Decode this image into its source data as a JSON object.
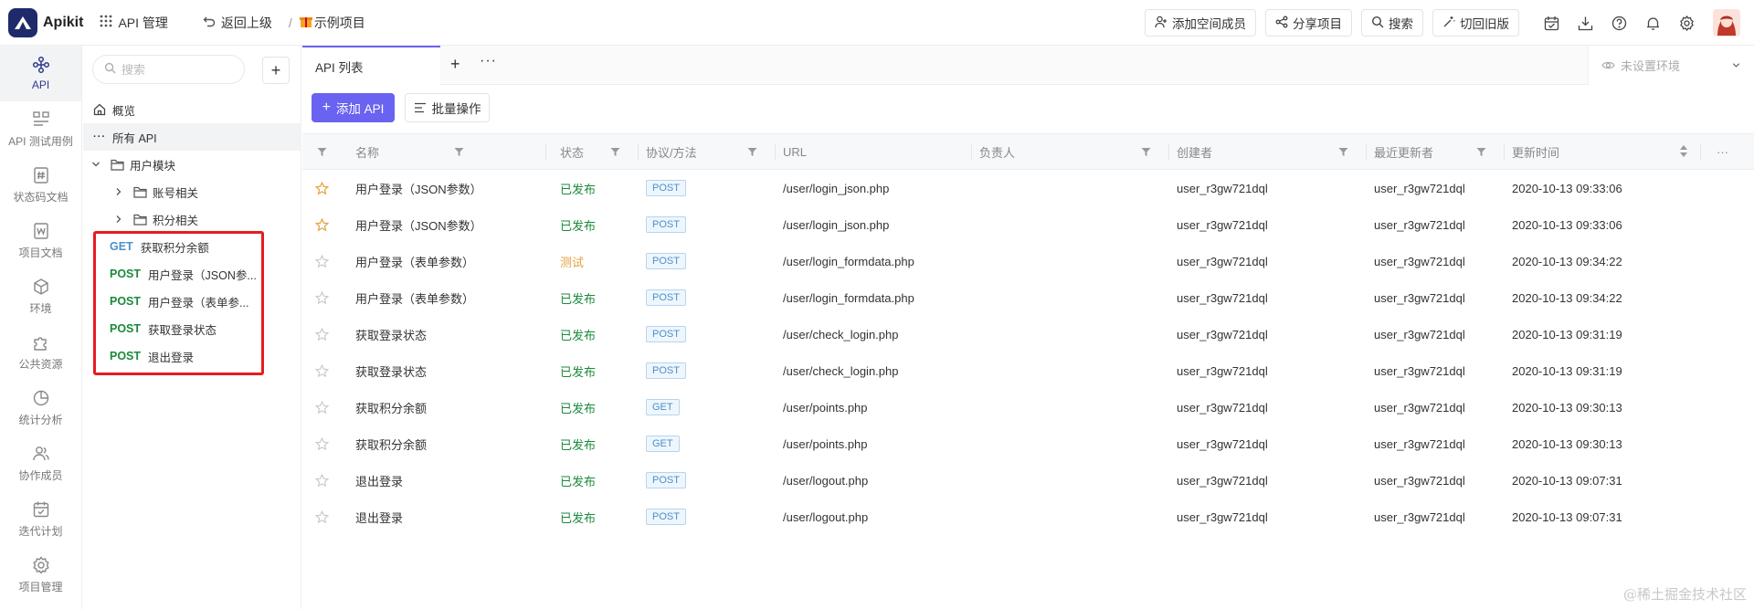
{
  "app": {
    "name": "Apikit"
  },
  "topnav": {
    "api_manage": "API 管理",
    "back": "返回上级",
    "separator": "/",
    "project": "示例项目"
  },
  "top_buttons": {
    "add_member": "添加空间成员",
    "share": "分享项目",
    "search": "搜索",
    "switch_old": "切回旧版"
  },
  "rail": {
    "items": [
      {
        "label": "API",
        "icon": "api-icon",
        "active": true
      },
      {
        "label": "API 测试用例",
        "icon": "test-case-icon"
      },
      {
        "label": "状态码文档",
        "icon": "status-code-icon"
      },
      {
        "label": "项目文档",
        "icon": "project-doc-icon"
      },
      {
        "label": "环境",
        "icon": "environment-icon"
      },
      {
        "label": "公共资源",
        "icon": "public-resource-icon"
      },
      {
        "label": "统计分析",
        "icon": "statistics-icon"
      },
      {
        "label": "协作成员",
        "icon": "members-icon"
      },
      {
        "label": "迭代计划",
        "icon": "iteration-icon"
      },
      {
        "label": "项目管理",
        "icon": "project-manage-icon"
      }
    ]
  },
  "tree": {
    "search_placeholder": "搜索",
    "overview": "概览",
    "all_api": "所有 API",
    "group": "用户模块",
    "subgroups": [
      "账号相关",
      "积分相关"
    ],
    "apis": [
      {
        "method": "GET",
        "name": "获取积分余额"
      },
      {
        "method": "POST",
        "name": "用户登录（JSON参..."
      },
      {
        "method": "POST",
        "name": "用户登录（表单参..."
      },
      {
        "method": "POST",
        "name": "获取登录状态"
      },
      {
        "method": "POST",
        "name": "退出登录"
      }
    ]
  },
  "tabs": {
    "active": "API 列表",
    "env_placeholder": "未设置环境"
  },
  "actions": {
    "add_api": "添加 API",
    "batch": "批量操作"
  },
  "table": {
    "headers": {
      "name": "名称",
      "status": "状态",
      "protocol": "协议/方法",
      "url": "URL",
      "owner": "负责人",
      "creator": "创建者",
      "updater": "最近更新者",
      "updated": "更新时间",
      "more": "···"
    },
    "rows": [
      {
        "starred": true,
        "name": "用户登录（JSON参数）",
        "status": "已发布",
        "status_type": "pub",
        "method": "POST",
        "url": "/user/login_json.php",
        "owner": "",
        "creator": "user_r3gw721dql",
        "updater": "user_r3gw721dql",
        "time": "2020-10-13 09:33:06"
      },
      {
        "starred": true,
        "name": "用户登录（JSON参数）",
        "status": "已发布",
        "status_type": "pub",
        "method": "POST",
        "url": "/user/login_json.php",
        "owner": "",
        "creator": "user_r3gw721dql",
        "updater": "user_r3gw721dql",
        "time": "2020-10-13 09:33:06"
      },
      {
        "starred": false,
        "name": "用户登录（表单参数）",
        "status": "测试",
        "status_type": "test",
        "method": "POST",
        "url": "/user/login_formdata.php",
        "owner": "",
        "creator": "user_r3gw721dql",
        "updater": "user_r3gw721dql",
        "time": "2020-10-13 09:34:22"
      },
      {
        "starred": false,
        "name": "用户登录（表单参数）",
        "status": "已发布",
        "status_type": "pub",
        "method": "POST",
        "url": "/user/login_formdata.php",
        "owner": "",
        "creator": "user_r3gw721dql",
        "updater": "user_r3gw721dql",
        "time": "2020-10-13 09:34:22"
      },
      {
        "starred": false,
        "name": "获取登录状态",
        "status": "已发布",
        "status_type": "pub",
        "method": "POST",
        "url": "/user/check_login.php",
        "owner": "",
        "creator": "user_r3gw721dql",
        "updater": "user_r3gw721dql",
        "time": "2020-10-13 09:31:19"
      },
      {
        "starred": false,
        "name": "获取登录状态",
        "status": "已发布",
        "status_type": "pub",
        "method": "POST",
        "url": "/user/check_login.php",
        "owner": "",
        "creator": "user_r3gw721dql",
        "updater": "user_r3gw721dql",
        "time": "2020-10-13 09:31:19"
      },
      {
        "starred": false,
        "name": "获取积分余额",
        "status": "已发布",
        "status_type": "pub",
        "method": "GET",
        "url": "/user/points.php",
        "owner": "",
        "creator": "user_r3gw721dql",
        "updater": "user_r3gw721dql",
        "time": "2020-10-13 09:30:13"
      },
      {
        "starred": false,
        "name": "获取积分余额",
        "status": "已发布",
        "status_type": "pub",
        "method": "GET",
        "url": "/user/points.php",
        "owner": "",
        "creator": "user_r3gw721dql",
        "updater": "user_r3gw721dql",
        "time": "2020-10-13 09:30:13"
      },
      {
        "starred": false,
        "name": "退出登录",
        "status": "已发布",
        "status_type": "pub",
        "method": "POST",
        "url": "/user/logout.php",
        "owner": "",
        "creator": "user_r3gw721dql",
        "updater": "user_r3gw721dql",
        "time": "2020-10-13 09:07:31"
      },
      {
        "starred": false,
        "name": "退出登录",
        "status": "已发布",
        "status_type": "pub",
        "method": "POST",
        "url": "/user/logout.php",
        "owner": "",
        "creator": "user_r3gw721dql",
        "updater": "user_r3gw721dql",
        "time": "2020-10-13 09:07:31"
      }
    ]
  },
  "watermark": "@稀土掘金技术社区",
  "colors": {
    "accent": "#6a62f0",
    "logo": "#1f2a6b",
    "published": "#1a8a3b",
    "testing": "#e6a23c",
    "get": "#4a90c9",
    "highlight": "#e51c23"
  }
}
